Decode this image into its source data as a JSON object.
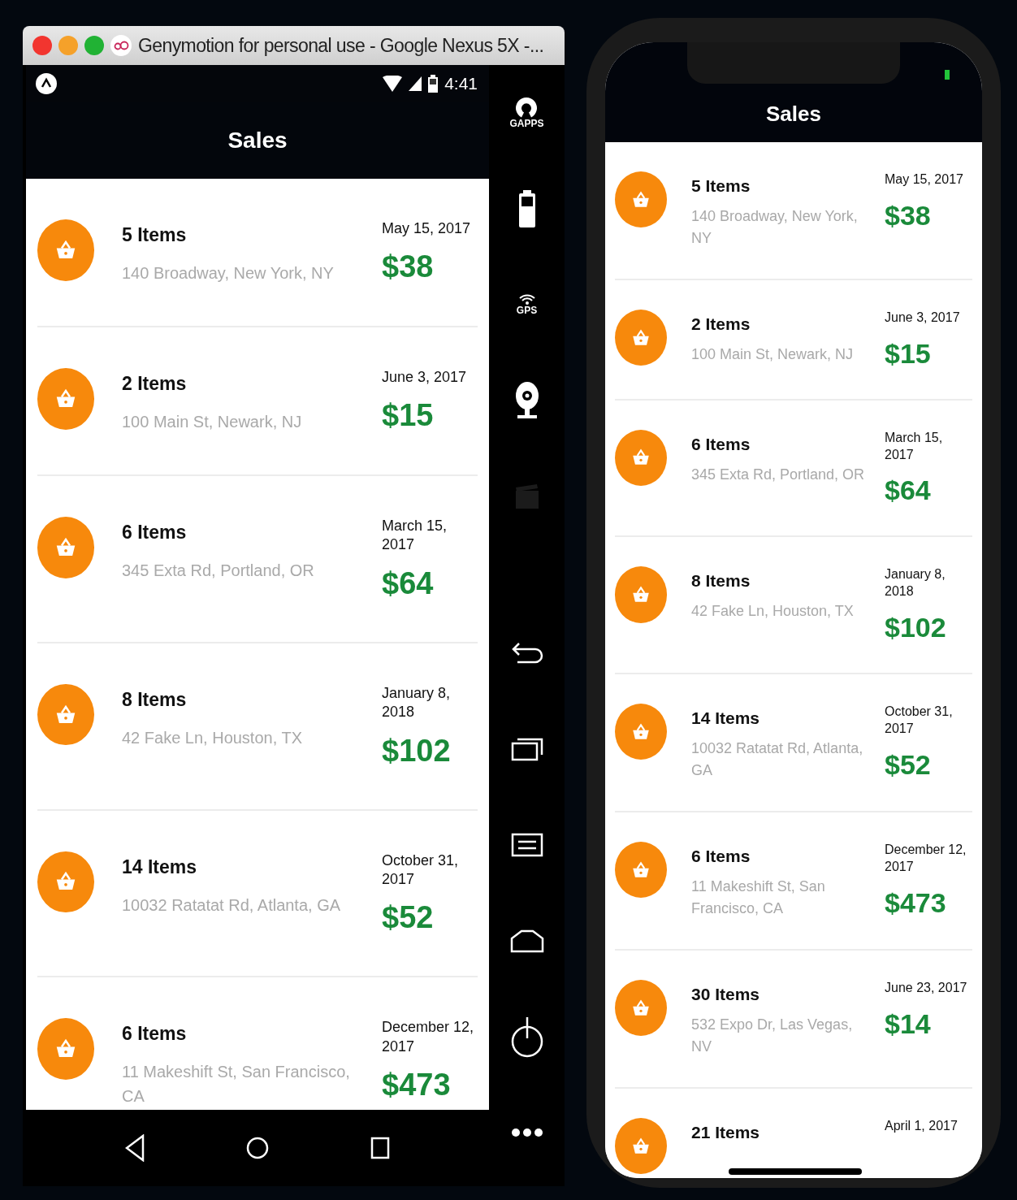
{
  "emulator": {
    "title": "Genymotion for personal use - Google Nexus 5X -...",
    "status_bar": {
      "time": "4:41"
    },
    "header": {
      "title": "Sales"
    },
    "sales": [
      {
        "items": "5 Items",
        "address": "140 Broadway, New York, NY",
        "date": "May 15, 2017",
        "total": "$38"
      },
      {
        "items": "2 Items",
        "address": "100 Main St, Newark, NJ",
        "date": "June 3, 2017",
        "total": "$15"
      },
      {
        "items": "6 Items",
        "address": "345 Exta Rd, Portland, OR",
        "date": "March 15, 2017",
        "total": "$64"
      },
      {
        "items": "8 Items",
        "address": "42 Fake Ln, Houston, TX",
        "date": "January 8, 2018",
        "total": "$102"
      },
      {
        "items": "14 Items",
        "address": "10032 Ratatat Rd, Atlanta, GA",
        "date": "October 31, 2017",
        "total": "$52"
      },
      {
        "items": "6 Items",
        "address": "11 Makeshift St, San Francisco, CA",
        "date": "December 12, 2017",
        "total": "$473"
      }
    ],
    "device_tools": [
      {
        "kind": "gapps",
        "label": "GAPPS",
        "disabled": false
      },
      {
        "kind": "battery",
        "disabled": false
      },
      {
        "kind": "gps",
        "label": "GPS",
        "disabled": false
      },
      {
        "kind": "camera",
        "disabled": false
      },
      {
        "kind": "media",
        "disabled": true
      }
    ],
    "navigation_tools": [
      {
        "kind": "back",
        "disabled": false
      },
      {
        "kind": "recents",
        "disabled": false
      },
      {
        "kind": "menu",
        "disabled": false
      },
      {
        "kind": "home",
        "disabled": false
      },
      {
        "kind": "power",
        "disabled": false
      },
      {
        "kind": "more",
        "disabled": false
      }
    ]
  },
  "iphone": {
    "header": {
      "title": "Sales"
    },
    "sales": [
      {
        "items": "5 Items",
        "address": "140 Broadway, New York, NY",
        "date": "May 15, 2017",
        "total": "$38"
      },
      {
        "items": "2 Items",
        "address": "100 Main St, Newark, NJ",
        "date": "June 3, 2017",
        "total": "$15"
      },
      {
        "items": "6 Items",
        "address": "345 Exta Rd, Portland, OR",
        "date": "March 15, 2017",
        "total": "$64"
      },
      {
        "items": "8 Items",
        "address": "42 Fake Ln, Houston, TX",
        "date": "January 8, 2018",
        "total": "$102"
      },
      {
        "items": "14 Items",
        "address": "10032 Ratatat Rd, Atlanta, GA",
        "date": "October 31, 2017",
        "total": "$52"
      },
      {
        "items": "6 Items",
        "address": "11 Makeshift St, San Francisco, CA",
        "date": "December 12, 2017",
        "total": "$473"
      },
      {
        "items": "30 Items",
        "address": "532 Expo Dr, Las Vegas, NV",
        "date": "June 23, 2017",
        "total": "$14"
      },
      {
        "items": "21 Items",
        "date": "April 1, 2017"
      }
    ]
  }
}
